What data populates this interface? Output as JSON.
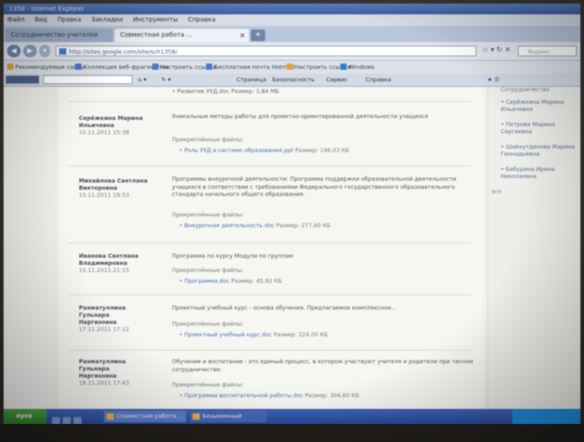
{
  "browser": {
    "window_title": "1358 - Internet Explorer",
    "menu": [
      "Файл",
      "Вид",
      "Правка",
      "Закладки",
      "Инструменты",
      "Справка"
    ],
    "tabs": [
      {
        "label": "Сотрудничество учителей школы"
      },
      {
        "label": "Совместная работа ..."
      }
    ],
    "address": "http://sites.google.com/site/sch1358/",
    "search_placeholder": "Яндекс",
    "bookmarks": [
      "Рекомендуемые сайты",
      "Коллекция веб-фрагментов",
      "Настроить ссылки",
      "Бесплатная почта Hotmail",
      "Настроить ссылки",
      "Windows Media",
      "Windows"
    ],
    "cmd_items": [
      "Страница",
      "Безопасность",
      "Сервис",
      "Справка"
    ]
  },
  "posts": [
    {
      "author": "Серёжкина Марина Ильичевна",
      "date": "15.11.2011 15:38",
      "text": "Уникальные методы работы для проектно-ориентированной деятельности учащихся",
      "attachments_title": "Прикреплённые файлы:",
      "attachment": "Роль УУД в системе образования.ppt",
      "attachment_size": "Размер: 146,03 КБ"
    },
    {
      "author": "Михайлова Светлана Викторовна",
      "date": "15.11.2011 19:53",
      "text": "Программы внеурочной деятельности: Программа поддержки образовательной деятельности учащихся в соответствии с требованиями Федерального государственного образовательного стандарта начального общего образования.",
      "attachments_title": "Прикреплённые файлы:",
      "attachment": "Внеурочная деятельность.doc",
      "attachment_size": "Размер: 277,60 КБ"
    },
    {
      "author": "Иванова Светлана Владимировна",
      "date": "15.11.2011 21:15",
      "text": "Программа по курсу Модули по группам",
      "attachments_title": "Прикреплённые файлы:",
      "attachment": "Программа.doc",
      "attachment_size": "Размер: 45,92 КБ"
    },
    {
      "author": "Рахматуллина Гульнара Наргизовна",
      "date": "17.11.2011 17:22",
      "text": "Проектный учебный курс - основа обучения. Предлагаемое комплексное...",
      "attachments_title": "Прикреплённые файлы:",
      "attachment": "Проектный учебный курс.doc",
      "attachment_size": "Размер: 224,00 КБ"
    },
    {
      "author": "Рахматуллина Гульнара Наргизовна",
      "date": "18.11.2011 17:43",
      "text": "Обучение и воспитание - это единый процесс, в котором участвуют учителя и родители при тесном сотрудничестве.",
      "attachments_title": "Прикреплённые файлы:",
      "attachment": "Программа воспитательной работы.doc",
      "attachment_size": "Размер: 304,60 КБ"
    }
  ],
  "top_bullet": "Развитие УУД.doc   Размер: 1,84 МБ",
  "sidebar": {
    "first": "Сотрудничество",
    "items": [
      "Серёжкина Марина Ильичевна",
      "Петрова Марина Сергеевна",
      "Шайхутдинова Марина Геннадьевна",
      "Бабурина Ирина Николаевна"
    ],
    "more": "все"
  },
  "taskbar": {
    "start": "пуск",
    "tasks": [
      "Совместная работа ...",
      "Безымянный"
    ]
  }
}
